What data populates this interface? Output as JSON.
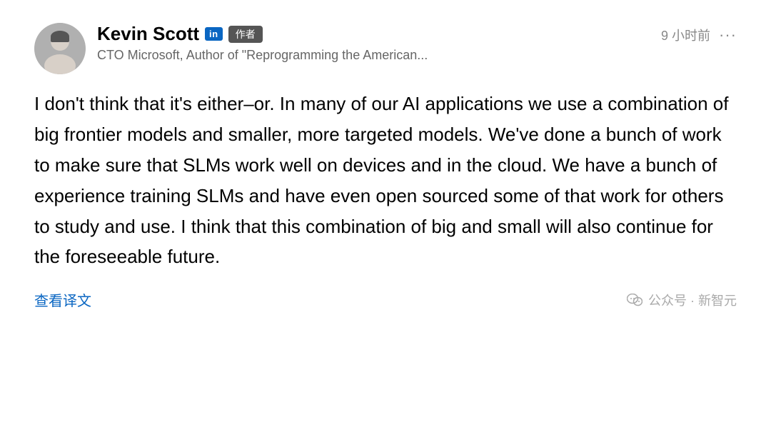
{
  "header": {
    "author_name": "Kevin Scott",
    "linkedin_label": "in",
    "author_badge": "作者",
    "author_title": "CTO Microsoft, Author of \"Reprogramming the American...",
    "time": "9 小时前",
    "more": "···"
  },
  "content": {
    "text": "I don't think that it's either–or. In many of our AI applications we use a combination of big frontier models and smaller, more targeted models. We've done a bunch of work to make sure that SLMs work well on devices and in the cloud. We have a bunch of experience training SLMs and have even open sourced some of that work for others to study and use. I think that this combination of big and small will also continue for the foreseeable future."
  },
  "footer": {
    "translate_label": "查看译文",
    "wechat_label": "公众号 · 新智元"
  }
}
